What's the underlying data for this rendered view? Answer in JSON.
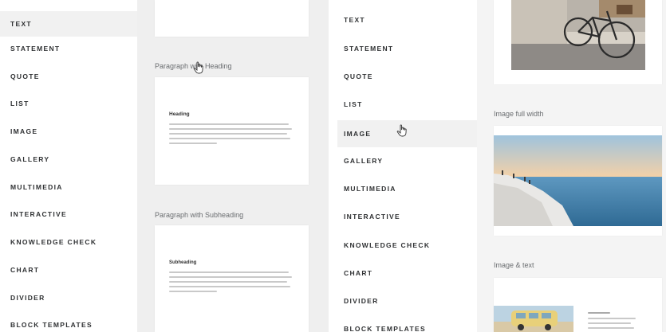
{
  "left_panel": {
    "menu_items": [
      {
        "label": "TEXT",
        "active": true
      },
      {
        "label": "STATEMENT"
      },
      {
        "label": "QUOTE"
      },
      {
        "label": "LIST"
      },
      {
        "label": "IMAGE"
      },
      {
        "label": "GALLERY"
      },
      {
        "label": "MULTIMEDIA"
      },
      {
        "label": "INTERACTIVE"
      },
      {
        "label": "KNOWLEDGE CHECK"
      },
      {
        "label": "CHART"
      },
      {
        "label": "DIVIDER"
      },
      {
        "label": "BLOCK TEMPLATES"
      }
    ],
    "previews": {
      "paragraph_heading_label": "Paragraph with Heading",
      "paragraph_heading_card_title": "Heading",
      "paragraph_subheading_label": "Paragraph with Subheading",
      "paragraph_subheading_card_title": "Subheading"
    }
  },
  "right_panel": {
    "menu_items": [
      {
        "label": "TEXT"
      },
      {
        "label": "STATEMENT"
      },
      {
        "label": "QUOTE"
      },
      {
        "label": "LIST"
      },
      {
        "label": "IMAGE",
        "active": true
      },
      {
        "label": "GALLERY"
      },
      {
        "label": "MULTIMEDIA"
      },
      {
        "label": "INTERACTIVE"
      },
      {
        "label": "KNOWLEDGE CHECK"
      },
      {
        "label": "CHART"
      },
      {
        "label": "DIVIDER"
      },
      {
        "label": "BLOCK TEMPLATES"
      }
    ],
    "previews": {
      "image_full_width_label": "Image full width",
      "image_text_label": "Image & text"
    }
  },
  "icons": [
    "hand-pointer-icon"
  ],
  "colors": {
    "menu_text": "#2f3133",
    "sky_top": "#9fc3dd",
    "sky_horizon": "#f3d1a8",
    "sea": "#3c7aa3"
  }
}
